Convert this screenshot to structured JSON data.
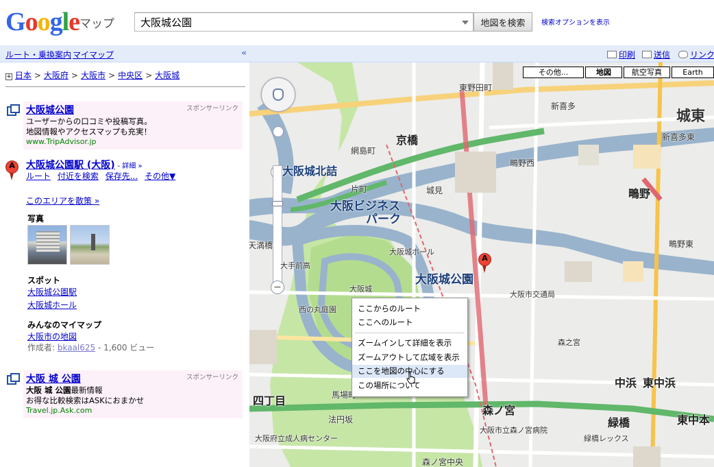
{
  "header": {
    "logo": "Google",
    "product": "マップ",
    "search_value": "大阪城公園",
    "search_button": "地図を検索",
    "search_options": "検索オプションを表示"
  },
  "left_top": {
    "route": "ルート・乗換案内",
    "mymap": "マイマップ",
    "collapse": "«"
  },
  "breadcrumb": [
    "日本",
    "大阪府",
    "大阪市",
    "中央区",
    "大阪城"
  ],
  "ad1": {
    "title": "大阪城公園",
    "line1": "ユーザーからの口コミや投稿写真。",
    "line2": "地図情報やアクセスマップも充実！",
    "url": "www.TripAdvisor.jp",
    "sponsor": "スポンサーリンク"
  },
  "result": {
    "marker": "A",
    "title": "大阪城公園駅 (大阪)",
    "detail": "- 詳細 »",
    "links": [
      "ルート",
      "付近を検索",
      "保存先...",
      "その他▼"
    ],
    "explore": "このエリアを散策 »",
    "photos_heading": "写真",
    "spots_heading": "スポット",
    "spots": [
      "大阪城公園駅",
      "大阪城ホール"
    ],
    "mymaps_heading": "みんなのマイマップ",
    "mymap_link": "大阪市の地図",
    "author_label": "作成者: ",
    "author": "bkaal625",
    "views": " - 1,600 ビュー"
  },
  "ad2": {
    "title": "大阪 城 公園",
    "line1_bold": "大阪 城 公園",
    "line1_rest": "最新情報",
    "line2": "お得な比較検索はASKにおまかせ",
    "url": "Travel.jp.Ask.com",
    "sponsor": "スポンサーリンク"
  },
  "map_toolbar": {
    "print": "印刷",
    "send": "送信",
    "link": "リンク"
  },
  "map_types": {
    "more": "その他...",
    "map": "地図",
    "satellite": "航空写真",
    "earth": "Earth"
  },
  "map_labels": {
    "kyobashi": "京橋",
    "osakajo_kitazume": "大阪城北詰",
    "business_park": "大阪ビジネス",
    "business_park2": "パーク",
    "osakajo_koen": "大阪城公園",
    "morinomiya": "森ノ宮",
    "ryokuen": "緑橋",
    "shijo": "四丁目",
    "shigino": "鴫野",
    "jotou": "城東",
    "temmabashi": "天満橋",
    "higashi_nodamachi": "東野田町",
    "nodamachi": "京橋",
    "higashi_shinbashi": "新喜多",
    "shingichi_higashi": "新喜多東",
    "katamachi": "片町",
    "aminojima": "網島町",
    "shigino_nishi": "鴫野西",
    "shigino_higashi": "鴫野東",
    "shiromi": "城見",
    "hall": "大阪城ホール",
    "osakajo": "大阪城",
    "nishinomaru": "西の丸庭園",
    "babacho": "馬場町",
    "hoenzaka": "法円坂",
    "chuohama": "中浜",
    "higashinakahama": "東中浜",
    "higashinakamoto": "東中本",
    "morinomiya_chuo": "森ノ宮中央",
    "osakashi_kotsu": "大阪市交通局",
    "shoin": "大手前高",
    "moriguchi": "森之宮",
    "ryokunbashi_lexus": "緑橋レックス",
    "hospital": "大阪府立成人病センター",
    "kotsu_byoin": "大阪市立森ノ宮病院"
  },
  "context_menu": {
    "items": [
      "ここからのルート",
      "ここへのルート",
      "ズームインして詳細を表示",
      "ズームアウトして広域を表示",
      "ここを地図の中心にする",
      "この場所について"
    ],
    "highlighted_index": 4
  }
}
